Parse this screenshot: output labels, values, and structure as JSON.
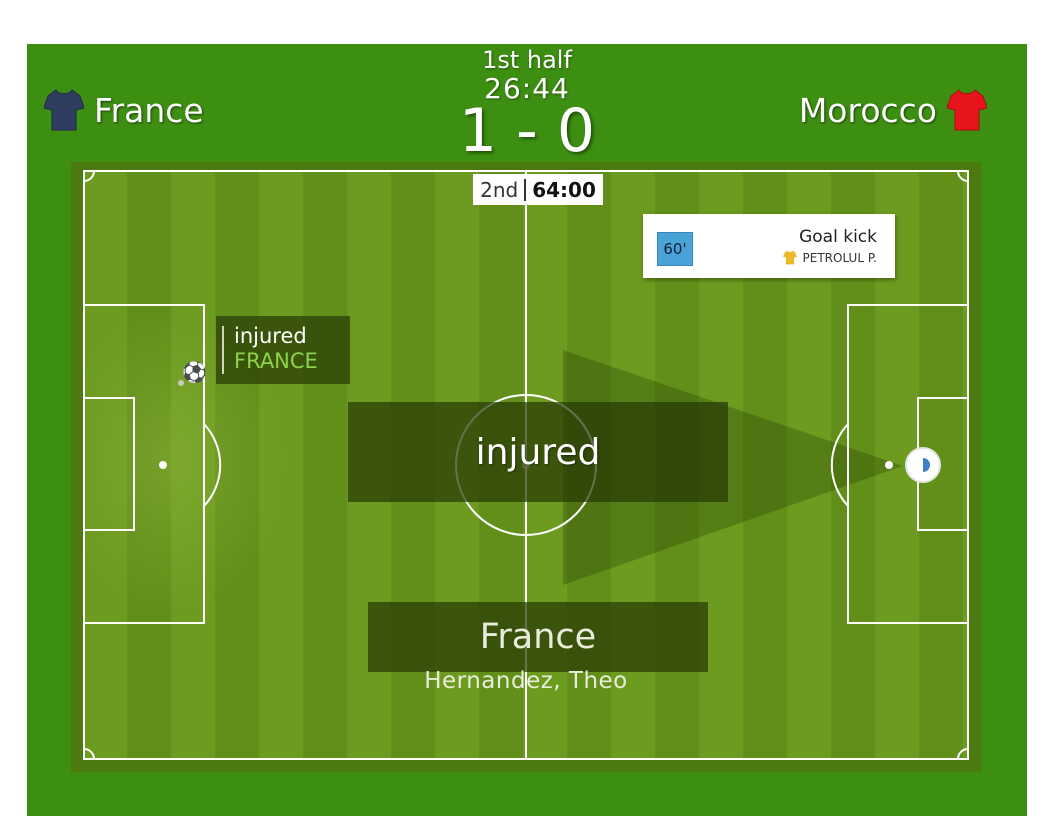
{
  "match": {
    "home_team": "France",
    "away_team": "Morocco",
    "period": "1st half",
    "clock": "26:44",
    "score": "1 - 0"
  },
  "colors": {
    "home_shirt": "#2f3d60",
    "away_shirt": "#e8141c",
    "event_team_shirt": "#e8b92a"
  },
  "mini_clock": {
    "period": "2nd",
    "time": "64:00"
  },
  "event_card": {
    "minute": "60'",
    "event": "Goal kick",
    "team": "PETROLUL P."
  },
  "ball_tag": {
    "event": "injured",
    "team": "FRANCE"
  },
  "overlay": {
    "event": "injured",
    "team": "France",
    "player": "Hernandez, Theo"
  },
  "icons": {
    "home_shirt": "shirt-icon",
    "away_shirt": "shirt-icon",
    "ball": "soccer-ball-icon"
  }
}
